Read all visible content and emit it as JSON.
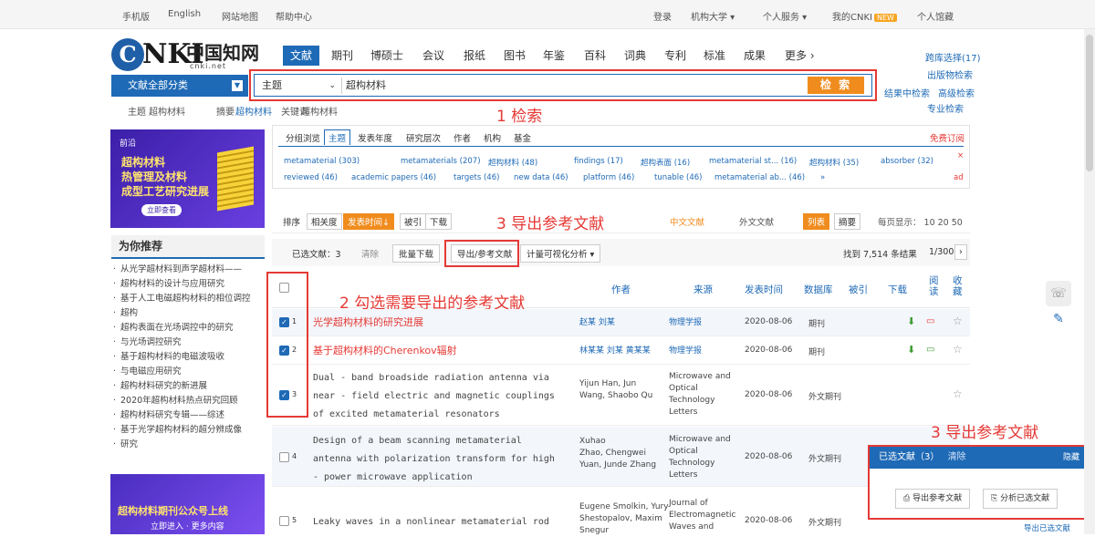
{
  "topbar": {
    "left": [
      "手机版",
      "English",
      "网站地图",
      "帮助中心"
    ],
    "right": [
      "登录",
      "机构大学 ▾",
      "个人服务 ▾",
      "我的CNKI",
      "NEW",
      "个人馆藏"
    ]
  },
  "logo": {
    "mark": "C",
    "letters": "NKI",
    "chinese": "中国知网",
    "url": "cnki.net"
  },
  "nav_tabs": [
    "文献",
    "期刊",
    "博硕士",
    "会议",
    "报纸",
    "图书",
    "年鉴",
    "百科",
    "词典",
    "专利",
    "标准",
    "成果",
    "更多 ›"
  ],
  "right_links": [
    "跨库选择(17)",
    "出版物检索",
    "结果中检索",
    "高级检索",
    "专业检索"
  ],
  "category_button": "文献全部分类",
  "search": {
    "field": "主题",
    "keyword": "超构材料",
    "button": "检 索"
  },
  "hotline": [
    "主题",
    "超构材料",
    "摘要",
    "超构材料",
    "关键词",
    "超构材料"
  ],
  "annotations": [
    "1 检索",
    "3 导出参考文献",
    "2 勾选需要导出的参考文献",
    "3 导出参考文献"
  ],
  "ad1": {
    "tag": "前沿",
    "title_lines": [
      "超构材料",
      "热管理及材料",
      "成型工艺研究进展"
    ],
    "button": "立即查看"
  },
  "left_heading": "为你推荐",
  "left_items": [
    "从光学超材料到声学超材料——",
    "超构材料的设计与应用研究",
    "基于人工电磁超构材料的相位调控",
    "超构",
    "超构表面在光场调控中的研究",
    "与光场调控研究",
    "基于超构材料的电磁波吸收",
    "与电磁应用研究",
    "超构材料研究的新进展",
    "2020年超构材料热点研究回顾",
    "超构材料研究专辑——综述",
    "基于光学超构材料的超分辨成像",
    "研究"
  ],
  "ad2": {
    "title": "超构材料期刊公众号上线",
    "sub": "立即进入  · 更多内容"
  },
  "filters": {
    "tabs": [
      "分组浏览",
      "主题",
      "发表年度",
      "研究层次",
      "作者",
      "机构",
      "基金"
    ],
    "row1": [
      "metamaterial (303)",
      "metamaterials (207)",
      "超构材料 (48)",
      "findings (17)",
      "超构表面 (16)",
      "metamaterial st... (16)",
      "超构材料 (35)",
      "absorber (32)"
    ],
    "row2": [
      "reviewed (46)",
      "academic papers (46)",
      "targets (46)",
      "new data (46)",
      "platform (46)",
      "tunable (46)",
      "metamaterial ab... (46)",
      "»"
    ],
    "close": "×",
    "end": "ad",
    "vis": "免费订阅"
  },
  "sort_bar": {
    "label": "排序",
    "options": [
      "相关度",
      "发表时间↓",
      "被引",
      "下载"
    ],
    "tools": [
      "中文文献",
      "外文文献"
    ],
    "view": [
      "列表",
      "摘要"
    ],
    "per_page": "每页显示： 10  20  50"
  },
  "action_bar": {
    "selected": "已选文献：3",
    "clear": "清除",
    "batch": "批量下载",
    "export": "导出/参考文献",
    "analysis": "计量可视化分析 ▾",
    "found": "找到 7,514 条结果",
    "page": "1/300",
    "next": "›"
  },
  "table_headers": [
    "作者",
    "来源",
    "发表时间",
    "数据库",
    "被引",
    "下载",
    "阅读",
    "收藏"
  ],
  "rows": [
    {
      "n": "1",
      "checked": true,
      "title": "光学超构材料的研究进展",
      "authors": "赵某 刘某",
      "source": "物理学报",
      "date": "2020-08-06",
      "db": "期刊"
    },
    {
      "n": "2",
      "checked": true,
      "title": "基于超构材料的Cherenkov辐射",
      "authors": "林某某  刘某  黄某某",
      "source": "物理学报",
      "date": "2020-08-06",
      "db": "期刊"
    },
    {
      "n": "3",
      "checked": true,
      "title_lines": [
        "Dual - band broadside radiation antenna via",
        "near - field electric and magnetic couplings",
        "of excited metamaterial resonators"
      ],
      "authors_lines": [
        "Yijun Han, Jun",
        "Wang, Shaobo Qu"
      ],
      "source_lines": [
        "Microwave and",
        "Optical",
        "Technology",
        "Letters"
      ],
      "date": "2020-08-06",
      "db": "外文期刊"
    },
    {
      "n": "4",
      "checked": false,
      "title_lines": [
        "Design of a beam scanning metamaterial",
        "antenna with polarization transform for high",
        "- power microwave application"
      ],
      "authors_lines": [
        "Xuhao",
        "Zhao, Chengwei",
        "Yuan, Junde Zhang"
      ],
      "source_lines": [
        "Microwave and",
        "Optical",
        "Technology",
        "Letters"
      ],
      "date": "2020-08-06",
      "db": "外文期刊"
    },
    {
      "n": "5",
      "checked": false,
      "title_lines": [
        "Leaky waves in a nonlinear metamaterial rod"
      ],
      "authors_lines": [
        "Eugene Smolkin, Yury",
        "Shestopalov, Maxim",
        "Snegur"
      ],
      "source_lines": [
        "Journal of",
        "Electromagnetic",
        "Waves and"
      ],
      "date": "2020-08-06",
      "db": "外文期刊"
    }
  ],
  "panel": {
    "title": "已选文献（3）",
    "clear": "清除",
    "close": "隐藏",
    "btn_export": "导出参考文献",
    "btn_analysis": "分析已选文献",
    "footer": "导出已选文献"
  }
}
